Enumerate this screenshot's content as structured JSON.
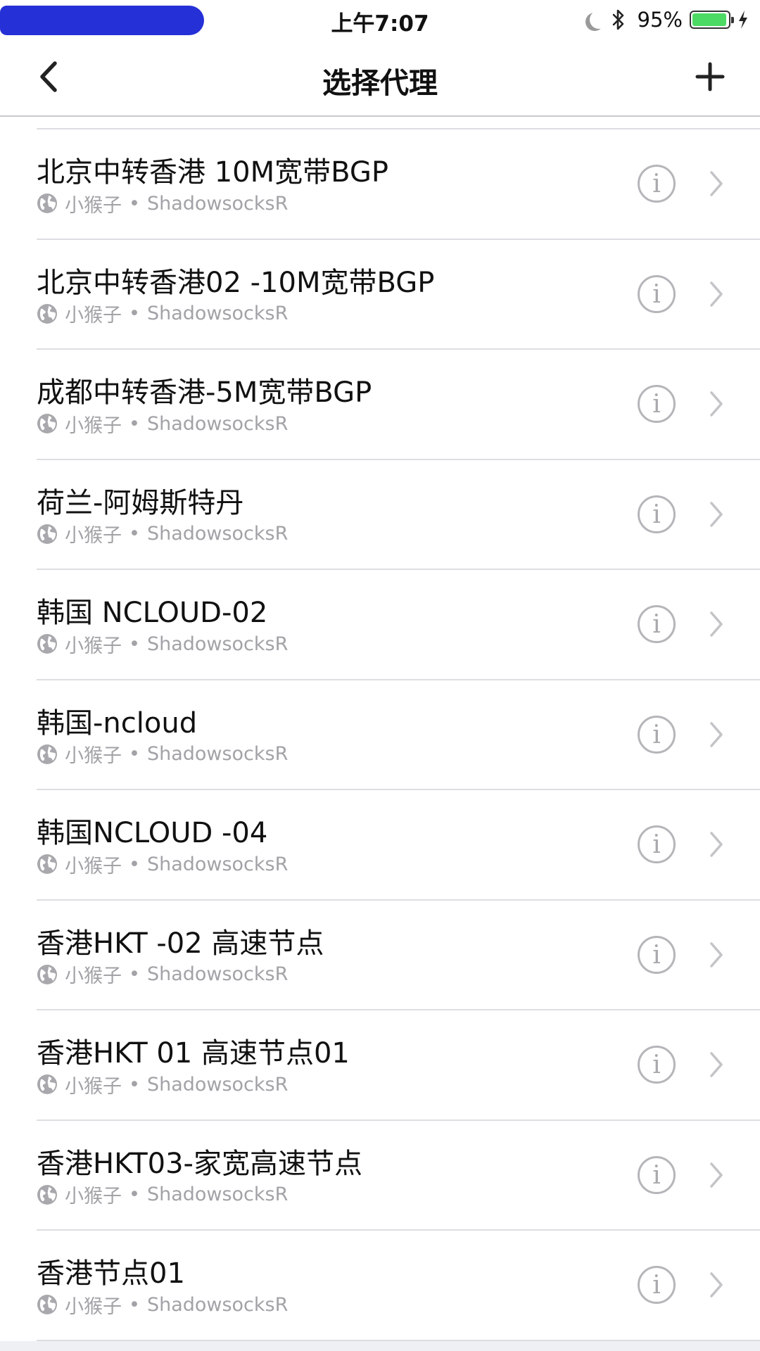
{
  "status_bar": {
    "time": "上午7:07",
    "battery_percent": "95%",
    "battery_level": 0.95,
    "icons": [
      "moon-icon",
      "bluetooth-icon",
      "battery-icon",
      "charging-bolt-icon"
    ]
  },
  "nav": {
    "title": "选择代理",
    "back_icon": "chevron-left-icon",
    "add_icon": "plus-icon"
  },
  "proxies": [
    {
      "name": "北京中转香港  10M宽带BGP",
      "group": "小猴子",
      "separator": "•",
      "type": "ShadowsocksR"
    },
    {
      "name": "北京中转香港02 -10M宽带BGP",
      "group": "小猴子",
      "separator": "•",
      "type": "ShadowsocksR"
    },
    {
      "name": "成都中转香港-5M宽带BGP",
      "group": "小猴子",
      "separator": "•",
      "type": "ShadowsocksR"
    },
    {
      "name": "荷兰-阿姆斯特丹",
      "group": "小猴子",
      "separator": "•",
      "type": "ShadowsocksR"
    },
    {
      "name": "韩国 NCLOUD-02",
      "group": "小猴子",
      "separator": "•",
      "type": "ShadowsocksR"
    },
    {
      "name": "韩国-ncloud",
      "group": "小猴子",
      "separator": "•",
      "type": "ShadowsocksR"
    },
    {
      "name": "韩国NCLOUD -04",
      "group": "小猴子",
      "separator": "•",
      "type": "ShadowsocksR"
    },
    {
      "name": "香港HKT -02 高速节点",
      "group": "小猴子",
      "separator": "•",
      "type": "ShadowsocksR"
    },
    {
      "name": "香港HKT 01  高速节点01",
      "group": "小猴子",
      "separator": "•",
      "type": "ShadowsocksR"
    },
    {
      "name": "香港HKT03-家宽高速节点",
      "group": "小猴子",
      "separator": "•",
      "type": "ShadowsocksR"
    },
    {
      "name": "香港节点01",
      "group": "小猴子",
      "separator": "•",
      "type": "ShadowsocksR"
    }
  ],
  "row_icons": {
    "leading": "globe-icon",
    "info": "info-icon",
    "info_glyph": "i",
    "trailing": "chevron-right-icon"
  },
  "colors": {
    "battery_green": "#4cd964",
    "secondary_text": "#a2a2a7",
    "separator": "#dedee2",
    "redaction": "#2530d6"
  }
}
